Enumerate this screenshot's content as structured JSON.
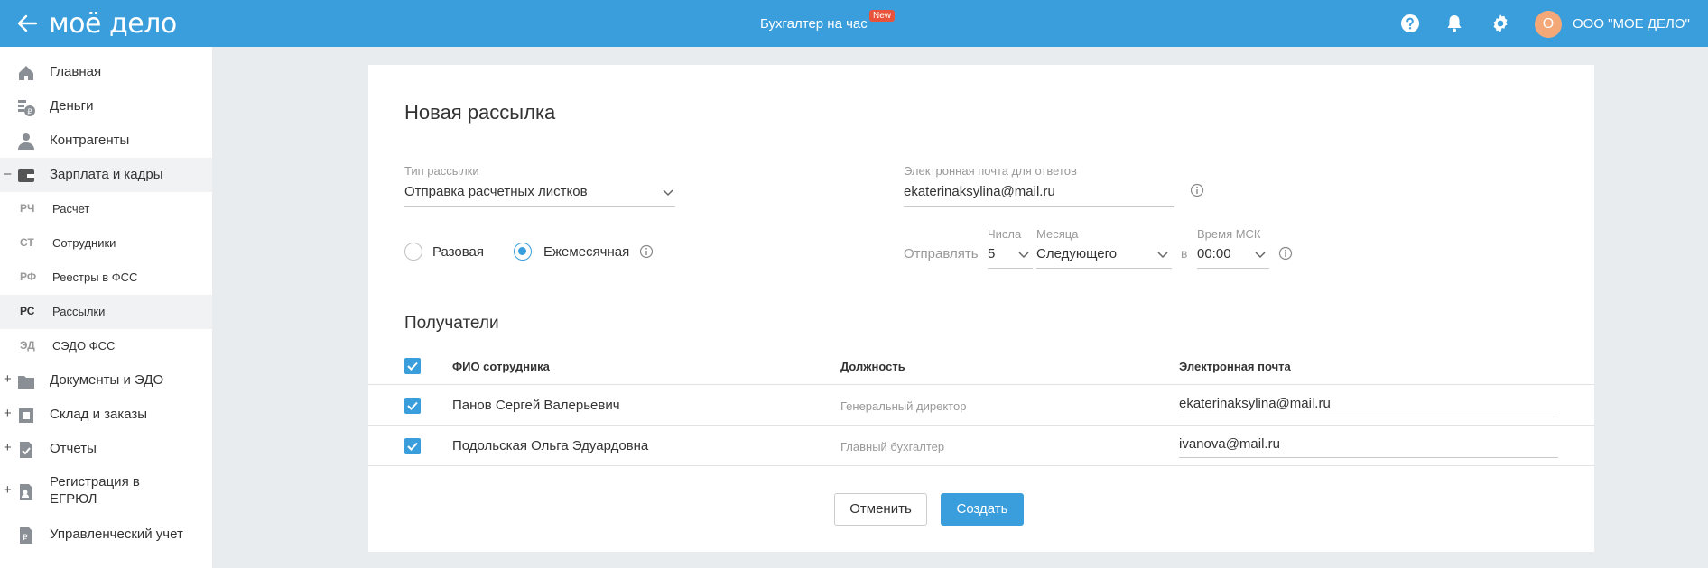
{
  "header": {
    "logo": "моё дело",
    "center_title": "Бухгалтер на час",
    "new_badge": "New",
    "avatar_letter": "О",
    "company": "ООО \"МОЕ ДЕЛО\"",
    "accent": "#3a9edc"
  },
  "sidebar": {
    "items": [
      {
        "label": "Главная",
        "icon": "home-icon"
      },
      {
        "label": "Деньги",
        "icon": "coins-icon"
      },
      {
        "label": "Контрагенты",
        "icon": "person-icon"
      },
      {
        "label": "Зарплата и кадры",
        "icon": "wallet-icon",
        "prefix": "–"
      },
      {
        "code": "РЧ",
        "label": "Расчет"
      },
      {
        "code": "СТ",
        "label": "Сотрудники"
      },
      {
        "code": "РФ",
        "label": "Реестры в ФСС"
      },
      {
        "code": "РС",
        "label": "Рассылки"
      },
      {
        "code": "ЭД",
        "label": "СЭДО ФСС"
      },
      {
        "label": "Документы и ЭДО",
        "icon": "folder-icon",
        "prefix": "+"
      },
      {
        "label": "Склад и заказы",
        "icon": "warehouse-icon",
        "prefix": "+"
      },
      {
        "label": "Отчеты",
        "icon": "report-icon",
        "prefix": "+"
      },
      {
        "label": "Регистрация в",
        "label2": "ЕГРЮЛ",
        "icon": "registration-icon",
        "prefix": "+"
      },
      {
        "label": "Управленческий учет",
        "icon": "management-icon"
      }
    ]
  },
  "form": {
    "title": "Новая рассылка",
    "type_label": "Тип рассылки",
    "type_value": "Отправка расчетных листков",
    "email_label": "Электронная почта для ответов",
    "email_value": "ekaterinaksylina@mail.ru",
    "radio_once": "Разовая",
    "radio_monthly": "Ежемесячная",
    "send_label": "Отправлять",
    "day_label": "Числа",
    "day_value": "5",
    "month_label": "Месяца",
    "month_value": "Следующего",
    "at_label": "в",
    "time_label": "Время МСК",
    "time_value": "00:00"
  },
  "recipients": {
    "title": "Получатели",
    "columns": [
      "ФИО сотрудника",
      "Должность",
      "Электронная почта"
    ],
    "rows": [
      {
        "name": "Панов Сергей Валерьевич",
        "position": "Генеральный директор",
        "email": "ekaterinaksylina@mail.ru"
      },
      {
        "name": "Подольская Ольга Эдуардовна",
        "position": "Главный бухгалтер",
        "email": "ivanova@mail.ru"
      }
    ]
  },
  "actions": {
    "cancel": "Отменить",
    "create": "Создать"
  }
}
